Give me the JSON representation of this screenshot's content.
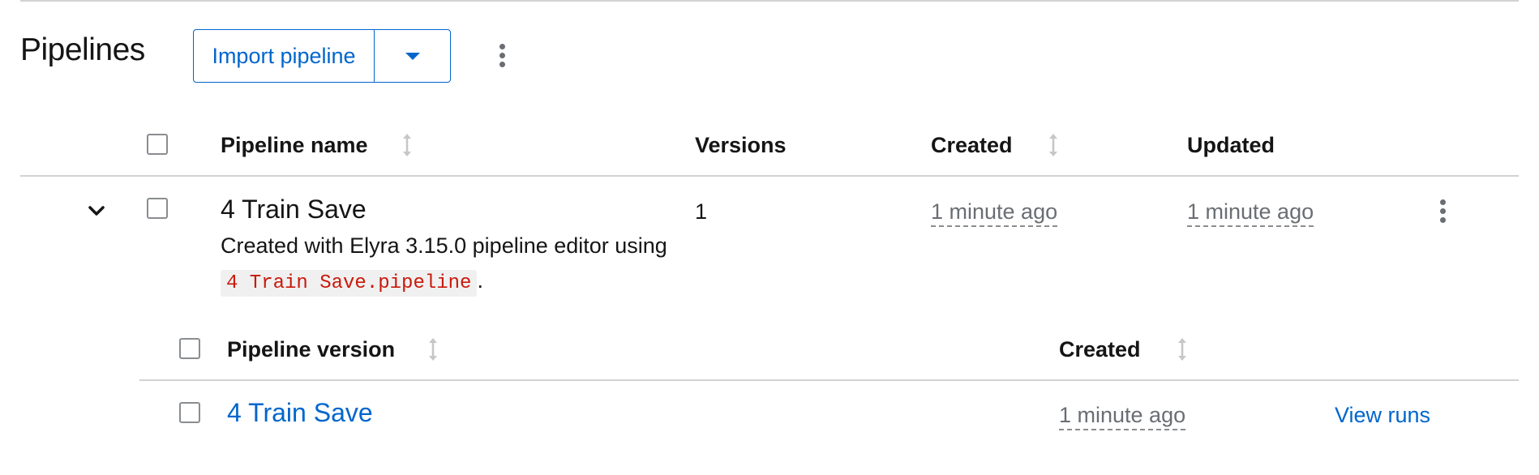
{
  "header": {
    "title": "Pipelines",
    "import_label": "Import pipeline"
  },
  "columns": {
    "name": "Pipeline name",
    "versions": "Versions",
    "created": "Created",
    "updated": "Updated"
  },
  "pipeline": {
    "name": "4 Train Save",
    "desc_pre": "Created with Elyra 3.15.0 pipeline editor using ",
    "desc_code": "4 Train Save.pipeline",
    "desc_post": ".",
    "versions": "1",
    "created": "1 minute ago",
    "updated": "1 minute ago"
  },
  "version_table": {
    "col_version": "Pipeline version",
    "col_created": "Created",
    "rows": [
      {
        "name": "4 Train Save",
        "created": "1 minute ago",
        "action": "View runs"
      }
    ]
  },
  "colors": {
    "accent": "#0066cc",
    "code": "#c9190b",
    "muted": "#6a6e73",
    "border": "#d2d2d2"
  }
}
